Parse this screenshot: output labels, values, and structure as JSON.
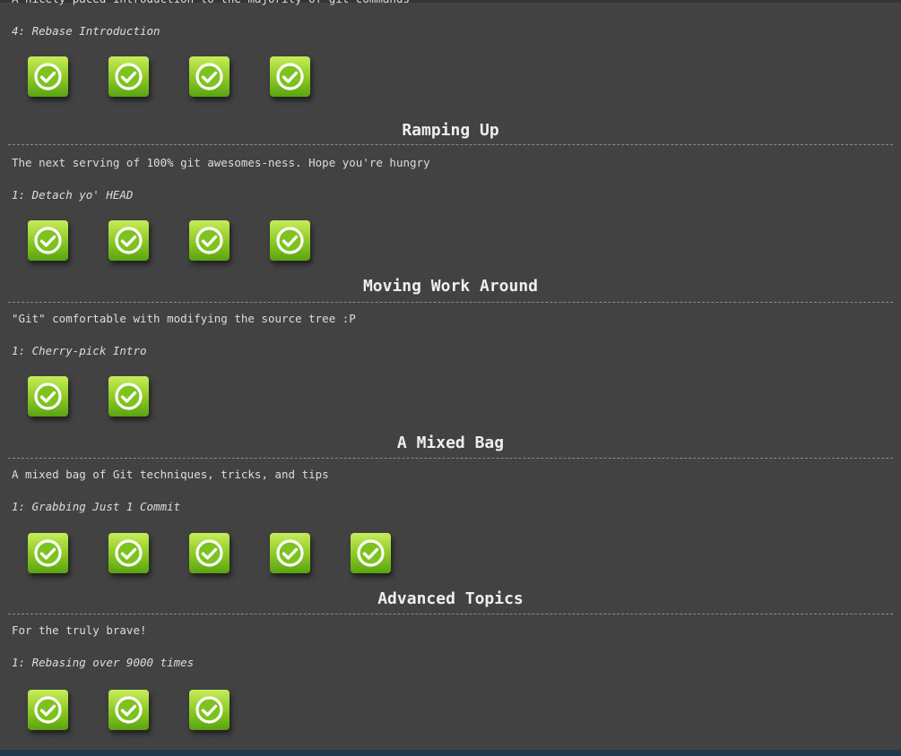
{
  "sequences": [
    {
      "id": "intro",
      "title": "",
      "about": "A nicely paced introduction to the majority of git commands",
      "selected_level": "4: Rebase Introduction",
      "levels": [
        {
          "name": "level-1",
          "completed": true
        },
        {
          "name": "level-2",
          "completed": true
        },
        {
          "name": "level-3",
          "completed": true
        },
        {
          "name": "level-4",
          "completed": true
        }
      ]
    },
    {
      "id": "rampup",
      "title": "Ramping Up",
      "about": "The next serving of 100% git awesomes-ness. Hope you're hungry",
      "selected_level": "1: Detach yo' HEAD",
      "levels": [
        {
          "name": "level-1",
          "completed": true
        },
        {
          "name": "level-2",
          "completed": true
        },
        {
          "name": "level-3",
          "completed": true
        },
        {
          "name": "level-4",
          "completed": true
        }
      ]
    },
    {
      "id": "move",
      "title": "Moving Work Around",
      "about": "\"Git\" comfortable with modifying the source tree :P",
      "selected_level": "1: Cherry-pick Intro",
      "levels": [
        {
          "name": "level-1",
          "completed": true
        },
        {
          "name": "level-2",
          "completed": true
        }
      ]
    },
    {
      "id": "mixed",
      "title": "A Mixed Bag",
      "about": "A mixed bag of Git techniques, tricks, and tips",
      "selected_level": "1: Grabbing Just 1 Commit",
      "levels": [
        {
          "name": "level-1",
          "completed": true
        },
        {
          "name": "level-2",
          "completed": true
        },
        {
          "name": "level-3",
          "completed": true
        },
        {
          "name": "level-4",
          "completed": true
        },
        {
          "name": "level-5",
          "completed": true
        }
      ]
    },
    {
      "id": "advanced",
      "title": "Advanced Topics",
      "about": "For the truly brave!",
      "selected_level": "1: Rebasing over 9000 times",
      "levels": [
        {
          "name": "level-1",
          "completed": true
        },
        {
          "name": "level-2",
          "completed": true
        },
        {
          "name": "level-3",
          "completed": true
        }
      ]
    }
  ],
  "colors": {
    "background": "#424242",
    "text": "#dddddd",
    "check_green": "#7ec21f"
  },
  "icons": {
    "completed": "checkmark-circle-icon"
  }
}
